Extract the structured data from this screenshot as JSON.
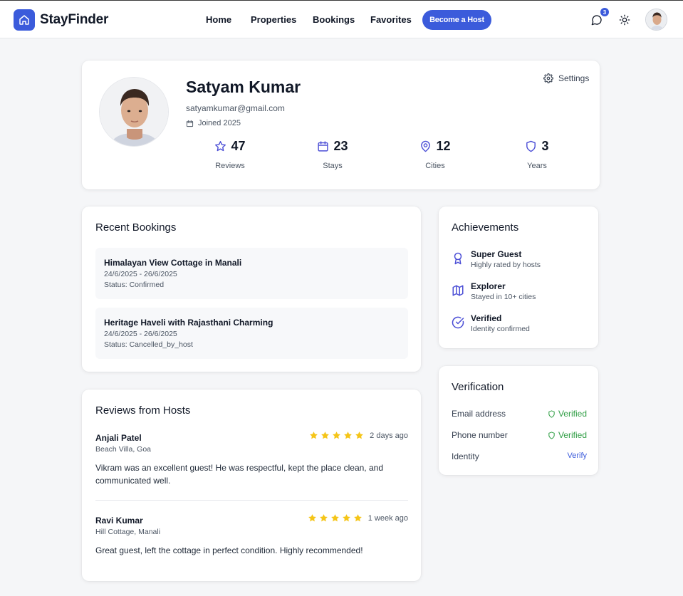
{
  "app": {
    "name": "StayFinder",
    "accent_color": "#3b5bdb"
  },
  "nav": {
    "links": [
      "Home",
      "Properties",
      "Bookings",
      "Favorites"
    ],
    "cta": "Become a Host",
    "notification_count": "3",
    "icons": [
      "chat-icon",
      "sun-icon"
    ]
  },
  "profile": {
    "name": "Satyam Kumar",
    "email": "satyamkumar@gmail.com",
    "joined": "Joined 2025",
    "settings_label": "Settings",
    "stats": [
      {
        "icon": "star-icon",
        "value": "47",
        "label": "Reviews"
      },
      {
        "icon": "calendar-icon",
        "value": "23",
        "label": "Stays"
      },
      {
        "icon": "map-pin-icon",
        "value": "12",
        "label": "Cities"
      },
      {
        "icon": "shield-icon",
        "value": "3",
        "label": "Years"
      }
    ]
  },
  "bookings": {
    "title": "Recent Bookings",
    "items": [
      {
        "name": "Himalayan View Cottage in Manali",
        "dates": "24/6/2025 - 26/6/2025",
        "status": "Status: Confirmed"
      },
      {
        "name": "Heritage Haveli with Rajasthani Charming",
        "dates": "24/6/2025 - 26/6/2025",
        "status": "Status: Cancelled_by_host"
      }
    ]
  },
  "reviews": {
    "title": "Reviews from Hosts",
    "star_color": "#f5c518",
    "items": [
      {
        "host": "Anjali Patel",
        "place": "Beach Villa, Goa",
        "rating": 5,
        "time": "2 days ago",
        "text": "Vikram was an excellent guest! He was respectful, kept the place clean, and communicated well."
      },
      {
        "host": "Ravi Kumar",
        "place": "Hill Cottage, Manali",
        "rating": 5,
        "time": "1 week ago",
        "text": "Great guest, left the cottage in perfect condition. Highly recommended!"
      }
    ]
  },
  "achievements": {
    "title": "Achievements",
    "items": [
      {
        "icon": "award-icon",
        "title": "Super Guest",
        "subtitle": "Highly rated by hosts"
      },
      {
        "icon": "map-icon",
        "title": "Explorer",
        "subtitle": "Stayed in 10+ cities"
      },
      {
        "icon": "check-circle-icon",
        "title": "Verified",
        "subtitle": "Identity confirmed"
      }
    ]
  },
  "verification": {
    "title": "Verification",
    "ok_color": "#2f9e44",
    "rows": [
      {
        "label": "Email address",
        "value": "Verified"
      },
      {
        "label": "Phone number",
        "value": "Verified"
      },
      {
        "label": "Identity",
        "value": "Verify"
      }
    ]
  }
}
